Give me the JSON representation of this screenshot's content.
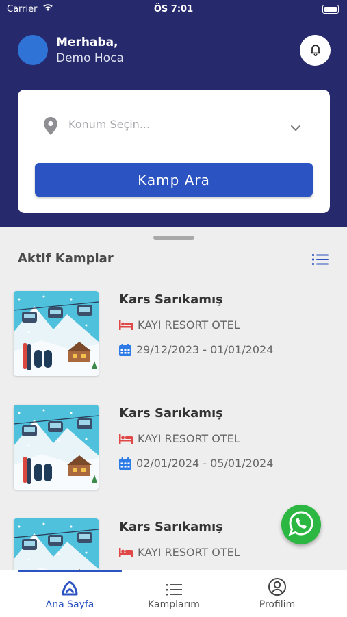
{
  "status_bar": {
    "carrier": "Carrier",
    "time": "ÖS 7:01"
  },
  "header": {
    "greeting": "Merhaba,",
    "user_name": "Demo Hoca"
  },
  "search_card": {
    "location_placeholder": "Konum Seçin...",
    "search_button": "Kamp Ara"
  },
  "section": {
    "title": "Aktif Kamplar"
  },
  "camps": [
    {
      "name": "Kars Sarıkamış",
      "hotel": "KAYI RESORT OTEL",
      "dates": "29/12/2023 - 01/01/2024"
    },
    {
      "name": "Kars Sarıkamış",
      "hotel": "KAYI RESORT OTEL",
      "dates": "02/01/2024 - 05/01/2024"
    },
    {
      "name": "Kars Sarıkamış",
      "hotel": "KAYI RESORT OTEL",
      "dates": ""
    }
  ],
  "tab_bar": {
    "items": [
      {
        "label": "Ana Sayfa",
        "icon": "home-icon",
        "active": true
      },
      {
        "label": "Kamplarım",
        "icon": "list-icon",
        "active": false
      },
      {
        "label": "Profilim",
        "icon": "profile-icon",
        "active": false
      }
    ]
  },
  "colors": {
    "header_bg": "#26296b",
    "accent": "#2b53c1",
    "whatsapp": "#2bb741",
    "hotel_icon": "#e04848"
  }
}
